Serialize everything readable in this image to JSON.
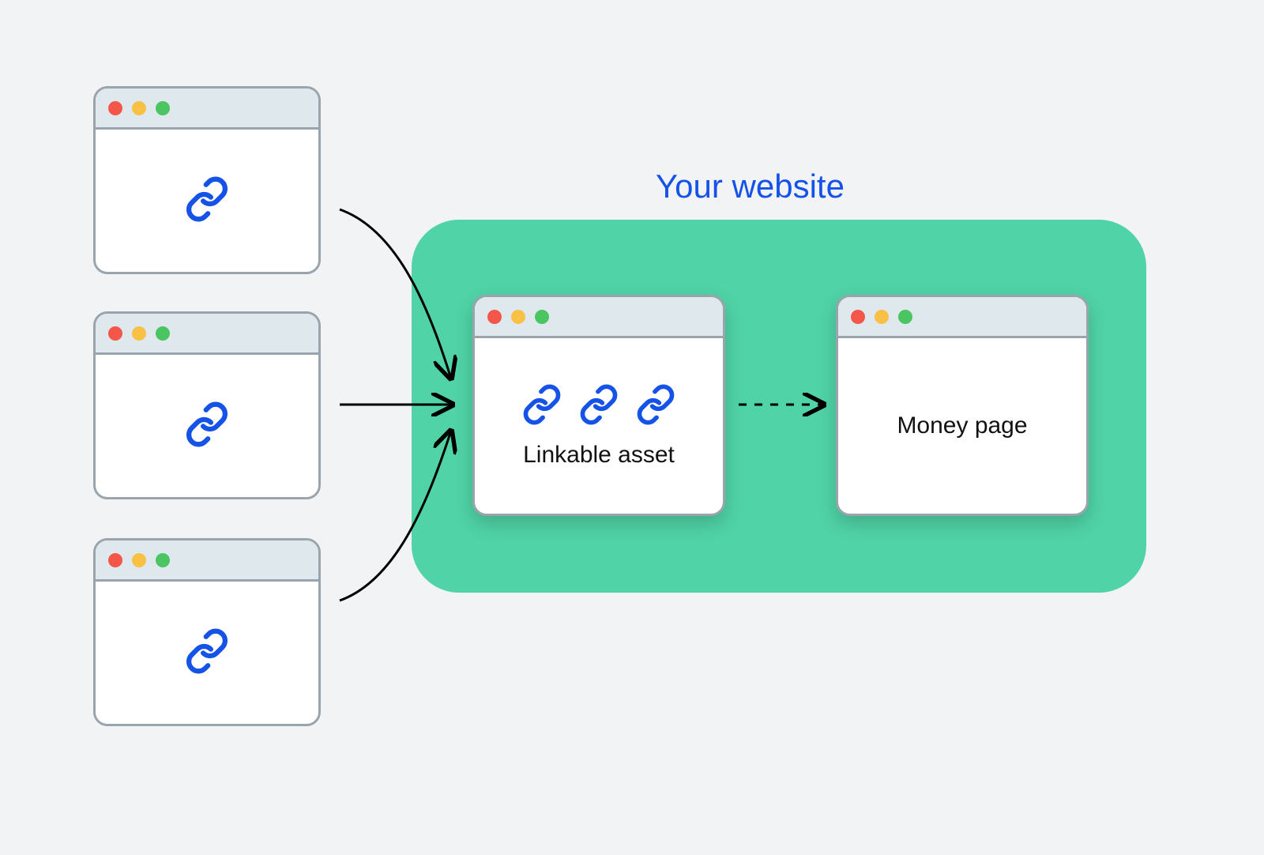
{
  "heading": "Your website",
  "linkable_asset_label": "Linkable asset",
  "money_page_label": "Money page",
  "colors": {
    "background": "#f1f3f5",
    "website_box": "#50d3a6",
    "heading_text": "#1552e8",
    "link_icon": "#1552e8",
    "window_border": "#9aa4ac",
    "titlebar": "#dfe8ed",
    "dot_red": "#f5564a",
    "dot_yellow": "#f8c146",
    "dot_green": "#4ac561"
  },
  "icons": {
    "link": "link-icon"
  }
}
